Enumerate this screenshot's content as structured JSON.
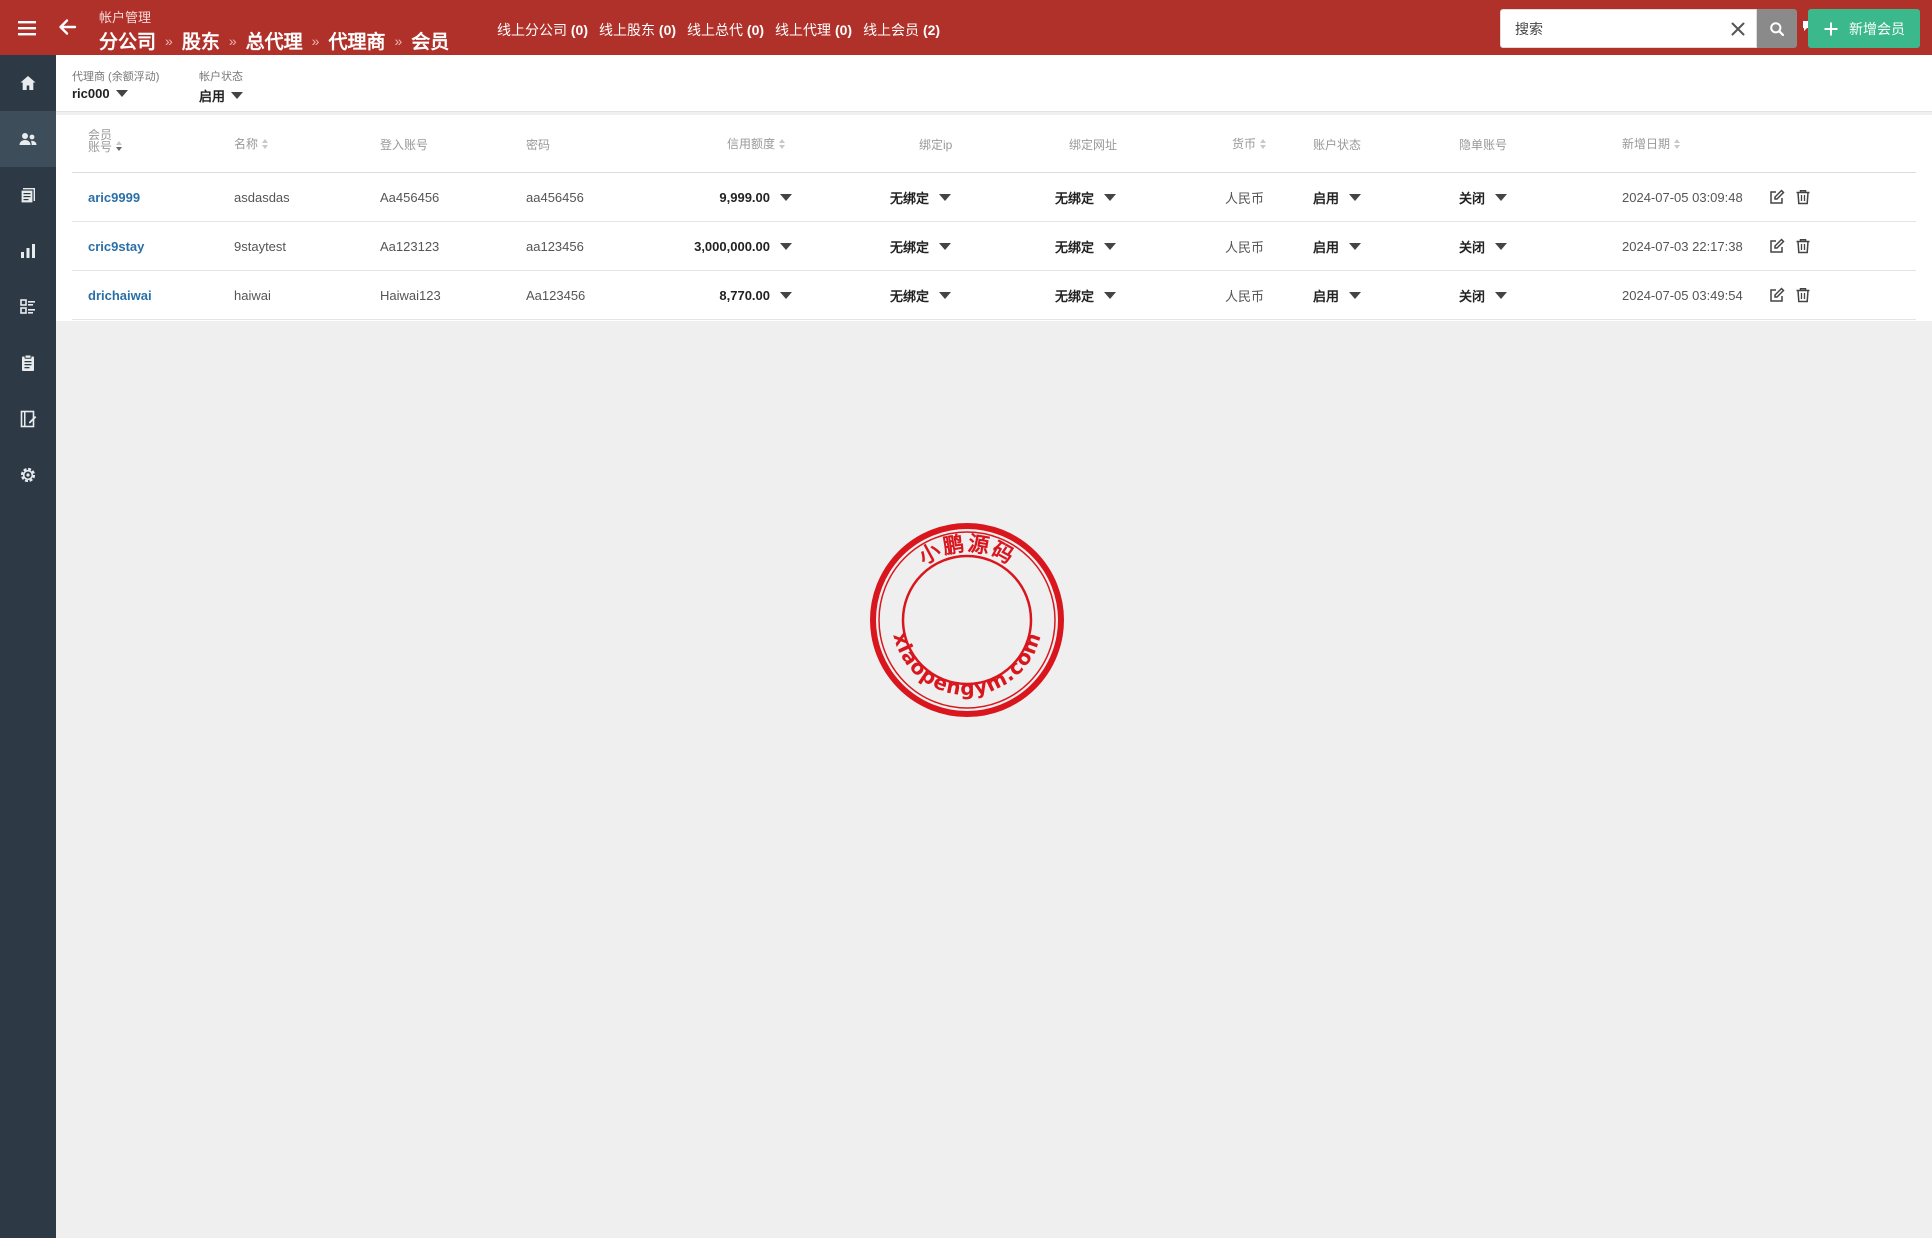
{
  "header": {
    "section_title": "帐户管理",
    "breadcrumb": [
      "分公司",
      "股东",
      "总代理",
      "代理商",
      "会员"
    ],
    "online": [
      {
        "label": "线上分公司",
        "count": "(0)"
      },
      {
        "label": "线上股东",
        "count": "(0)"
      },
      {
        "label": "线上总代",
        "count": "(0)"
      },
      {
        "label": "线上代理",
        "count": "(0)"
      },
      {
        "label": "线上会员",
        "count": "(2)"
      }
    ],
    "icons": [
      "search-user-icon",
      "bell-icon",
      "chat-icon",
      "lightning-icon",
      "user-icon"
    ]
  },
  "sidebar": {
    "items": [
      "home-icon",
      "users-icon",
      "reports-icon",
      "chart-icon",
      "list-icon",
      "clipboard-icon",
      "notebook-icon",
      "settings-icon"
    ],
    "active_index": 1
  },
  "filters": {
    "agent_label": "代理商 (余额浮动)",
    "agent_value": "ric000",
    "status_label": "帐户状态",
    "status_value": "启用"
  },
  "search": {
    "placeholder": "搜索",
    "add_label": "新增会员"
  },
  "table": {
    "headers": {
      "account": [
        "会员",
        "账号"
      ],
      "name": "名称",
      "login": "登入账号",
      "password": "密码",
      "credit": "信用额度",
      "bind_ip": "绑定ip",
      "bind_url": "绑定网址",
      "currency": "货币",
      "status": "账户状态",
      "hidden": "隐单账号",
      "date": "新增日期"
    },
    "rows": [
      {
        "account": "aric9999",
        "name": "asdasdas",
        "login": "Aa456456",
        "password": "aa456456",
        "credit": "9,999.00",
        "bind_ip": "无绑定",
        "bind_url": "无绑定",
        "currency": "人民币",
        "status": "启用",
        "hidden": "关闭",
        "date": "2024-07-05 03:09:48"
      },
      {
        "account": "cric9stay",
        "name": "9staytest",
        "login": "Aa123123",
        "password": "aa123456",
        "credit": "3,000,000.00",
        "bind_ip": "无绑定",
        "bind_url": "无绑定",
        "currency": "人民币",
        "status": "启用",
        "hidden": "关闭",
        "date": "2024-07-03 22:17:38"
      },
      {
        "account": "drichaiwai",
        "name": "haiwai",
        "login": "Haiwai123",
        "password": "Aa123456",
        "credit": "8,770.00",
        "bind_ip": "无绑定",
        "bind_url": "无绑定",
        "currency": "人民币",
        "status": "启用",
        "hidden": "关闭",
        "date": "2024-07-05 03:49:54"
      }
    ]
  },
  "watermark": {
    "top_text": "小鹏源码",
    "bottom_text": "xiaopengym.com",
    "color": "#d9161d"
  },
  "colors": {
    "topbar": "#b0302a",
    "sidebar": "#2d3a45",
    "accent_green": "#3bb98c",
    "link_blue": "#2a6fa8"
  }
}
